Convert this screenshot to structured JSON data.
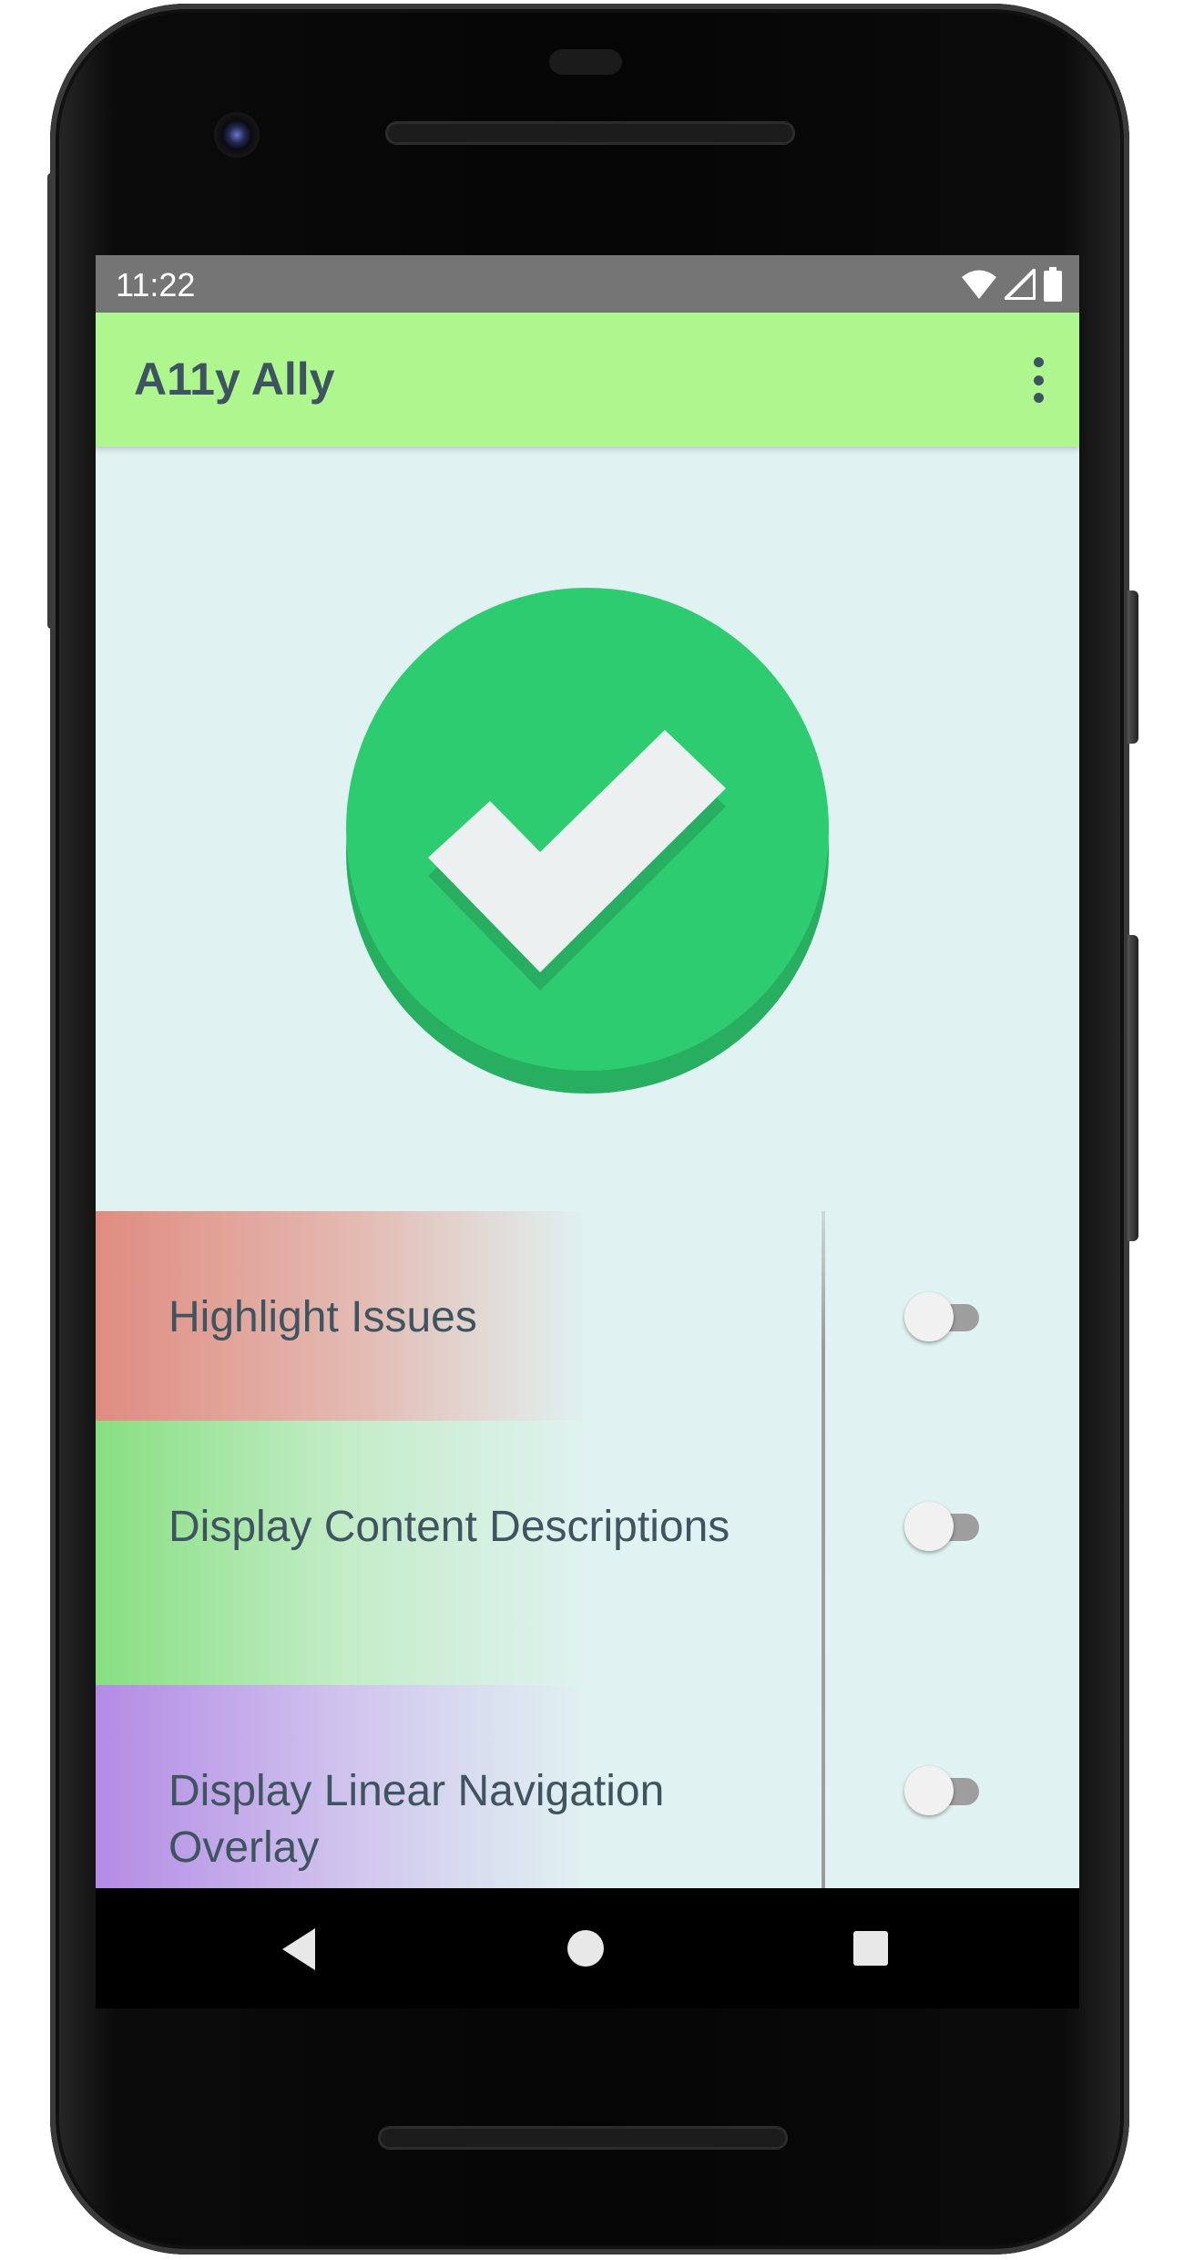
{
  "status_bar": {
    "time": "11:22"
  },
  "app_bar": {
    "title": "A11y Ally"
  },
  "status_icon": {
    "name": "checkmark-success",
    "color": "#2ecc71",
    "shadow_color": "#27ae60",
    "check_color": "#ecf0f1"
  },
  "settings": [
    {
      "label": "Highlight Issues",
      "enabled": false,
      "accent": "#e08c80"
    },
    {
      "label": "Display Content Descriptions",
      "enabled": false,
      "accent": "#87df80"
    },
    {
      "label": "Display Linear Navigation Overlay",
      "enabled": false,
      "accent": "#b38be4"
    }
  ],
  "colors": {
    "app_bar": "#aef78f",
    "background": "#e0f2f1",
    "text": "#3f5460",
    "status_bar": "#757575"
  }
}
